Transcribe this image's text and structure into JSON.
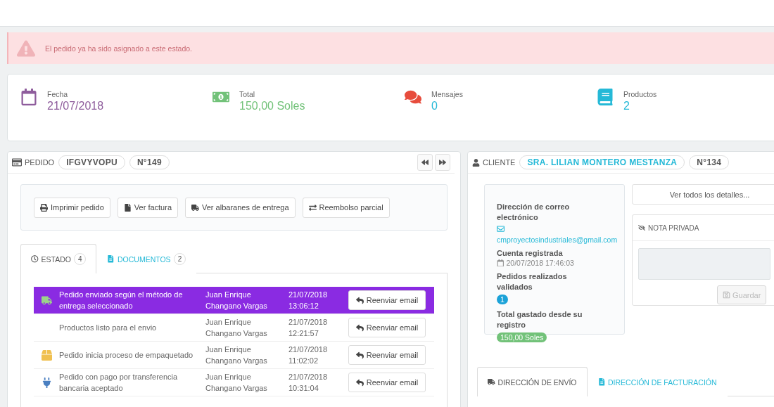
{
  "alert": {
    "text": "El pedido ya ha sido asignado a este estado."
  },
  "kpis": [
    {
      "kind": "date",
      "label": "Fecha",
      "value": "21/07/2018",
      "color": "#8e5c9c"
    },
    {
      "kind": "money",
      "label": "Total",
      "value": "150,00 Soles",
      "color": "#72c279"
    },
    {
      "kind": "messages",
      "label": "Mensajes",
      "value": "0",
      "color": "#e74c3c"
    },
    {
      "kind": "products",
      "label": "Productos",
      "value": "2",
      "color": "#25b9d7"
    }
  ],
  "order_panel": {
    "title": "PEDIDO",
    "reference": "IFGVYVOPU",
    "number": "N°149",
    "nav": [
      {
        "kind": "previous"
      },
      {
        "kind": "next"
      }
    ],
    "actions": [
      {
        "kind": "print",
        "label": "Imprimir pedido"
      },
      {
        "kind": "invoice",
        "label": "Ver factura"
      },
      {
        "kind": "delivery",
        "label": "Ver albaranes de entrega"
      },
      {
        "kind": "refund",
        "label": "Reembolso parcial"
      }
    ],
    "tabs": [
      {
        "kind": "status",
        "label": "ESTADO",
        "count": "4",
        "selected": true
      },
      {
        "kind": "documents",
        "label": "DOCUMENTOS",
        "count": "2",
        "selected": false
      }
    ],
    "history": [
      {
        "kind": "shipped",
        "status": "Pedido enviado según el método de entrega seleccionado",
        "employee": "Juan Enrique Changano Vargas",
        "date": "21/07/2018 13:06:12",
        "button": "Reenviar email",
        "current": true
      },
      {
        "kind": "ready",
        "status": "Productos listo para el envio",
        "employee": "Juan Enrique Changano Vargas",
        "date": "21/07/2018 12:21:57",
        "button": "Reenviar email",
        "current": false
      },
      {
        "kind": "packaging",
        "status": "Pedido inicia proceso de empaquetado",
        "employee": "Juan Enrique Changano Vargas",
        "date": "21/07/2018 11:02:02",
        "button": "Reenviar email",
        "current": false
      },
      {
        "kind": "payment",
        "status": "Pedido con pago por transferencia bancaria aceptado",
        "employee": "Juan Enrique Changano Vargas",
        "date": "21/07/2018 10:31:04",
        "button": "Reenviar email",
        "current": false
      }
    ]
  },
  "customer_panel": {
    "title": "CLIENTE",
    "name": "SRA. LILIAN MONTERO MESTANZA",
    "number": "N°134",
    "email_label": "Dirección de correo electrónico",
    "email": "cmproyectosindustriales@gmail.com",
    "registered_label": "Cuenta registrada",
    "registered": "20/07/2018 17:46:03",
    "orders_label": "Pedidos realizados validados",
    "orders": "1",
    "spent_label": "Total gastado desde su registro",
    "spent": "150,00 Soles",
    "details_button": "Ver todos los detalles...",
    "note": {
      "title": "NOTA PRIVADA",
      "button": "Guardar",
      "disabled": true
    },
    "tabs": [
      {
        "kind": "shipping",
        "label": "DIRECCIÓN DE ENVÍO",
        "selected": true
      },
      {
        "kind": "invoice",
        "label": "DIRECCIÓN DE FACTURACIÓN",
        "selected": false
      }
    ]
  }
}
